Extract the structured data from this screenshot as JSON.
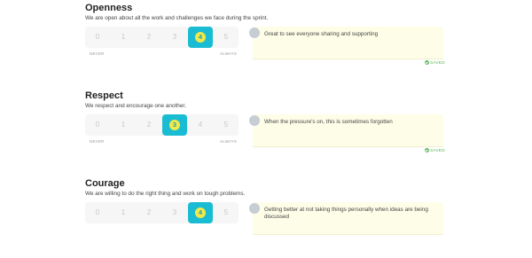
{
  "sections": [
    {
      "title": "Openness",
      "description": "We are open about all the work and challenges we face during the sprint.",
      "scale": [
        "0",
        "1",
        "2",
        "3",
        "4",
        "5"
      ],
      "selected": 4,
      "never_label": "NEVER",
      "always_label": "ALWAYS",
      "comment": "Great to see everyone sharing and supporting",
      "saved_label": "SAVED"
    },
    {
      "title": "Respect",
      "description": "We respect and encourage one another.",
      "scale": [
        "0",
        "1",
        "2",
        "3",
        "4",
        "5"
      ],
      "selected": 3,
      "never_label": "NEVER",
      "always_label": "ALWAYS",
      "comment": "When the pressure's on, this is sometimes forgotten",
      "saved_label": "SAVED"
    },
    {
      "title": "Courage",
      "description": "We are willing to do the right thing and work on tough problems.",
      "scale": [
        "0",
        "1",
        "2",
        "3",
        "4",
        "5"
      ],
      "selected": 4,
      "comment": "Getting better at not taking things personally when ideas are being discussed"
    }
  ],
  "colors": {
    "selected": "#19bcd2",
    "selected_dot": "#f1e94a",
    "note_bg": "#fefee8",
    "saved": "#5fb35a"
  }
}
